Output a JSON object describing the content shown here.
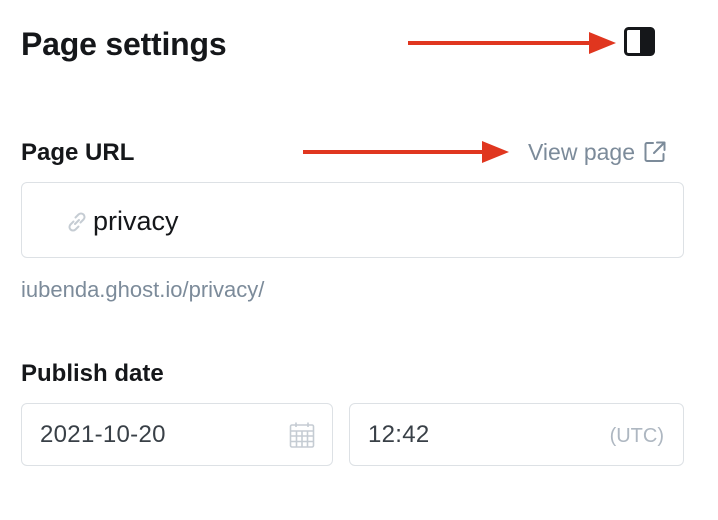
{
  "header": {
    "title": "Page settings",
    "toggle_icon": "sidebar-toggle-icon"
  },
  "page_url": {
    "label": "Page URL",
    "view_link_label": "View page",
    "view_link_icon": "external-link-icon",
    "input_icon": "link-icon",
    "value": "privacy",
    "hint": "iubenda.ghost.io/privacy/"
  },
  "publish_date": {
    "label": "Publish date",
    "date_value": "2021-10-20",
    "date_icon": "calendar-icon",
    "time_value": "12:42",
    "timezone": "(UTC)"
  },
  "annotations": {
    "arrow_color": "#e0361f"
  },
  "colors": {
    "text": "#15171a",
    "muted": "#7c8b9a",
    "border": "#dde1e5"
  }
}
